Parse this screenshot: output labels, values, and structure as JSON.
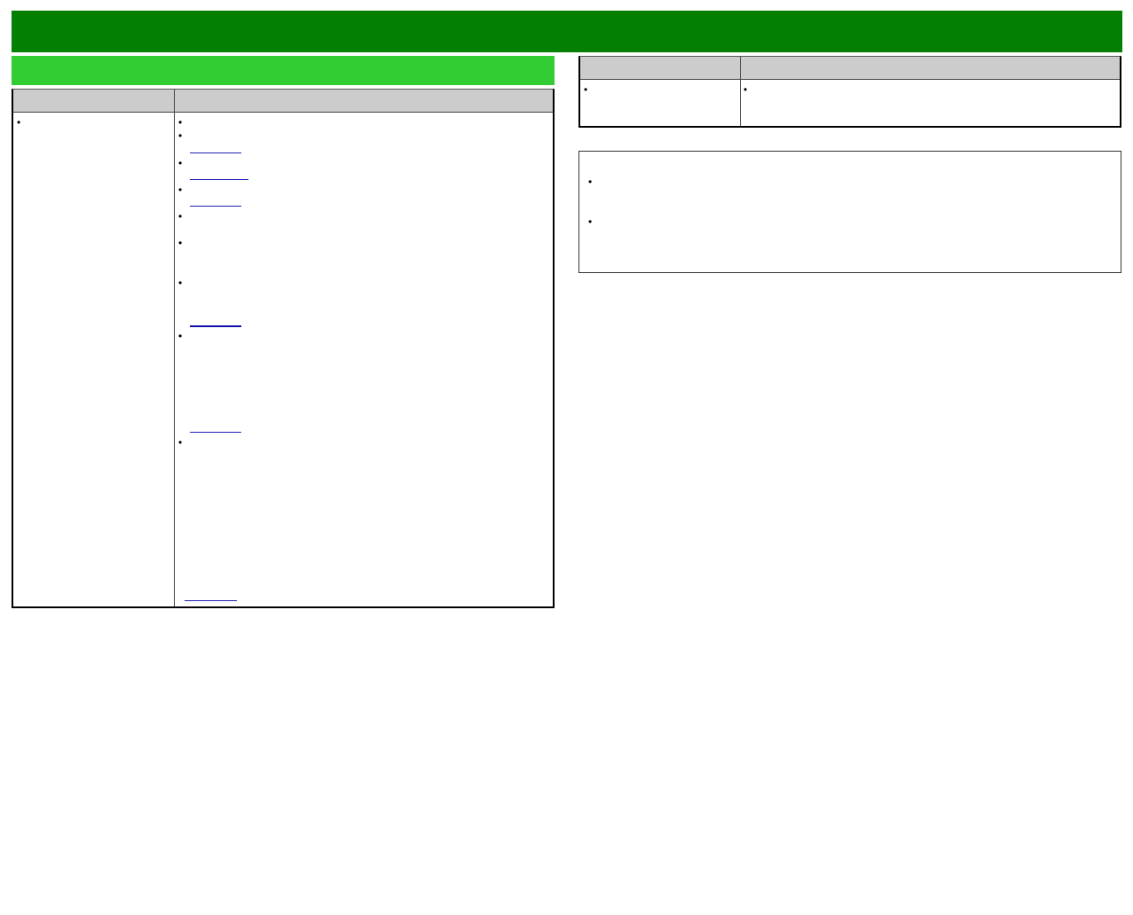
{
  "colors": {
    "banner": "#038003",
    "section_header": "#33cc33",
    "table_header": "#cccccc",
    "link": "#1f1fb8",
    "border": "#000000"
  },
  "banner": {
    "title": ""
  },
  "left_section": {
    "title": "",
    "table": {
      "headers": [
        "",
        ""
      ],
      "col1_items": [
        ""
      ],
      "col2_items": [
        "",
        "",
        "",
        "",
        "",
        "",
        "",
        "",
        "",
        ""
      ],
      "links": [
        "",
        "",
        "",
        "",
        "",
        "",
        ""
      ]
    }
  },
  "right_table": {
    "headers": [
      "",
      ""
    ],
    "col1_items": [
      ""
    ],
    "col2_items": [
      ""
    ]
  },
  "notes": {
    "items": [
      "",
      ""
    ]
  }
}
